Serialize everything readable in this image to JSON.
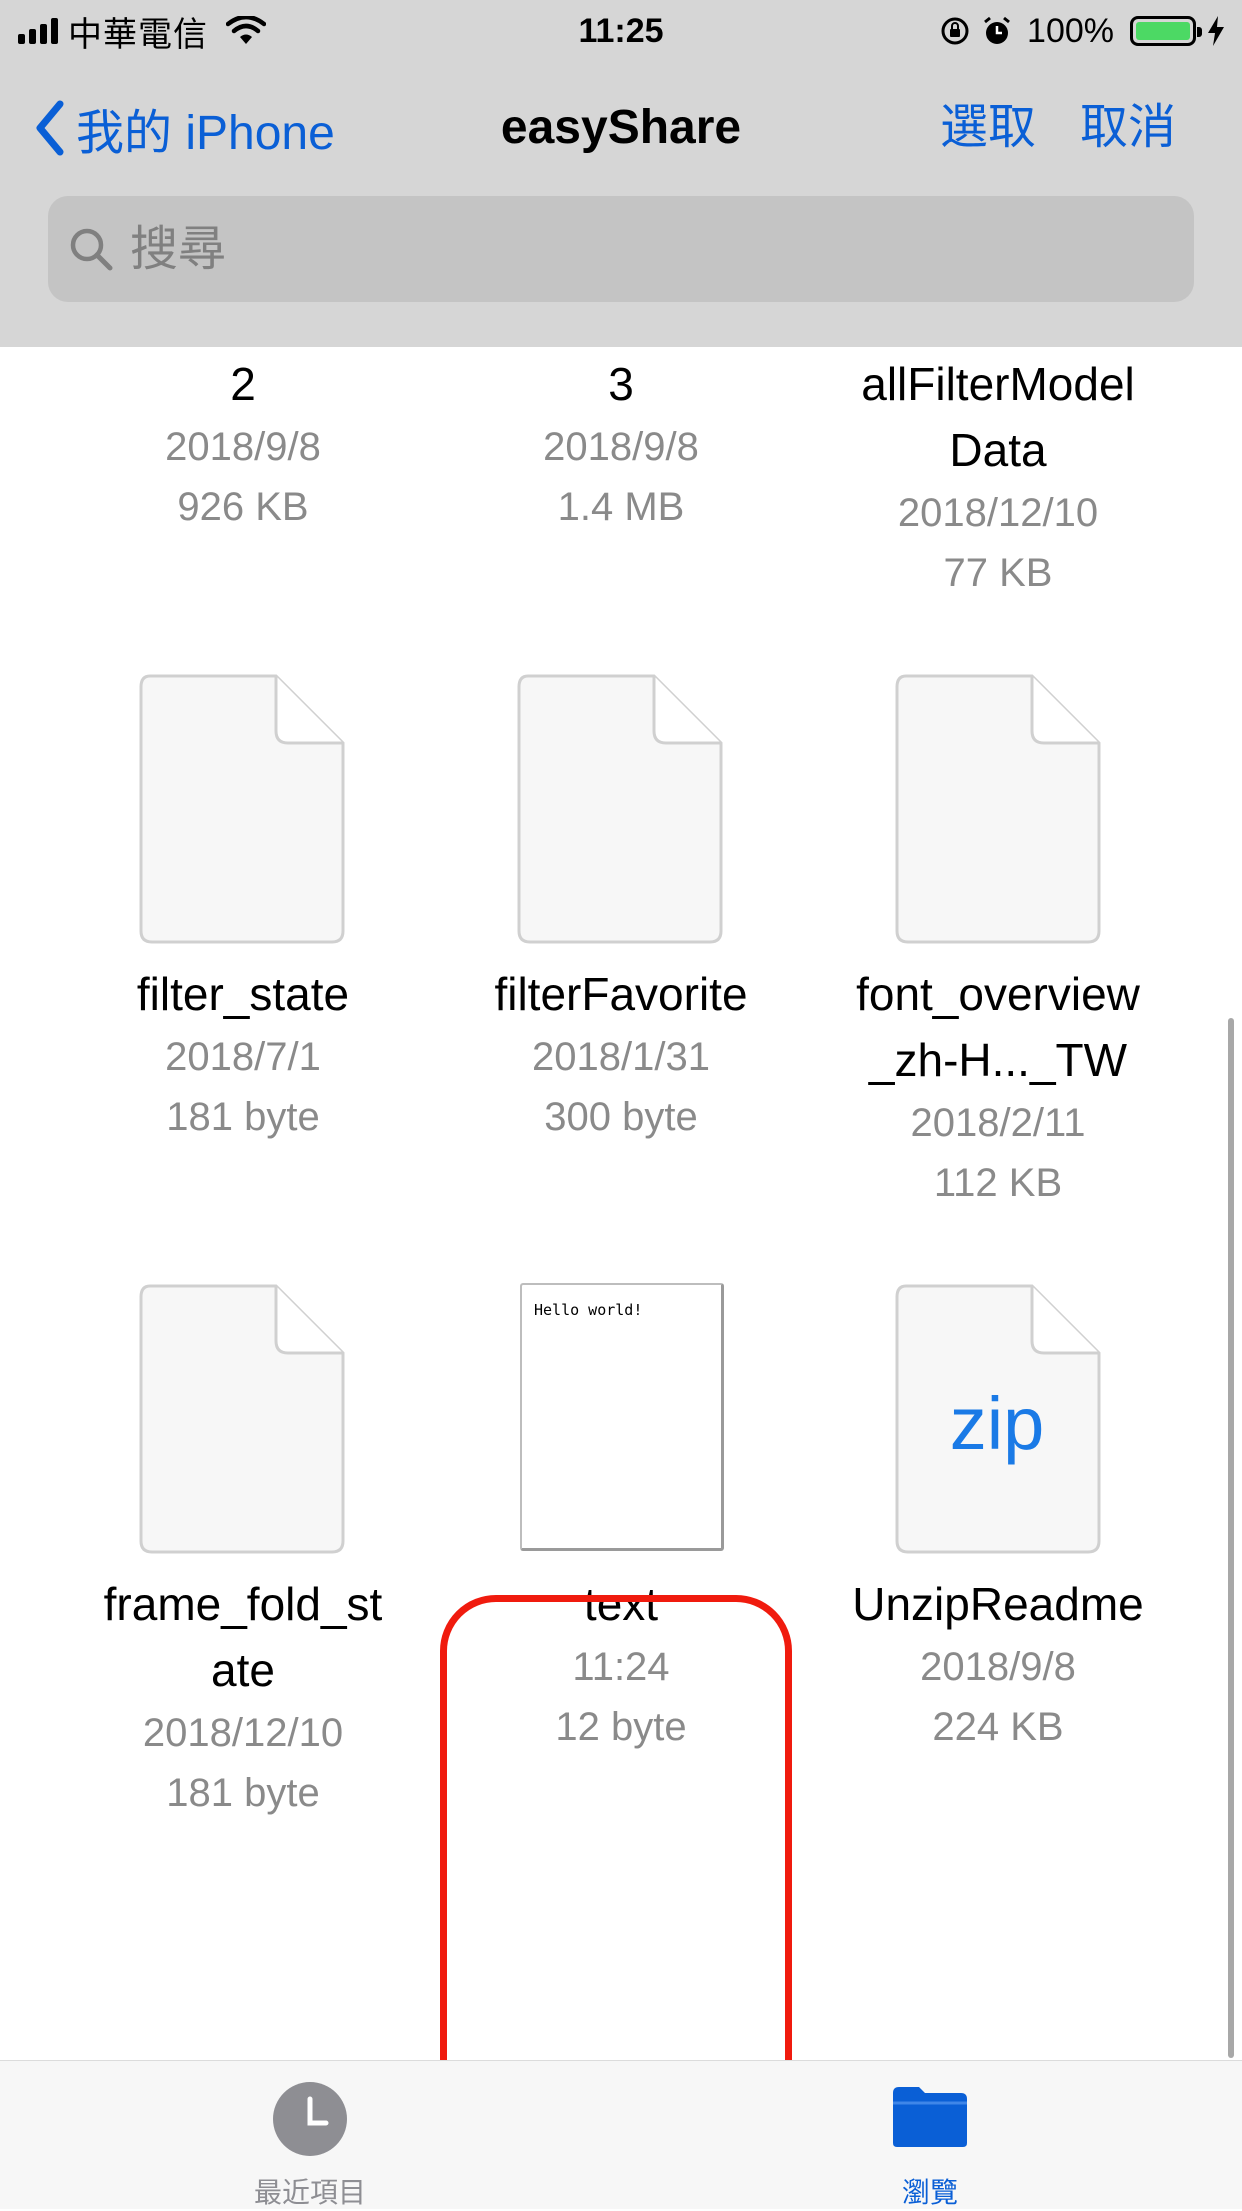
{
  "status_bar": {
    "carrier": "中華電信",
    "time": "11:25",
    "battery_percent": "100%"
  },
  "nav": {
    "back_label": "我的 iPhone",
    "title": "easyShare",
    "select_label": "選取",
    "cancel_label": "取消"
  },
  "search": {
    "placeholder": "搜尋"
  },
  "files": [
    {
      "name_lines": [
        "2"
      ],
      "date": "2018/9/8",
      "size": "926 KB"
    },
    {
      "name_lines": [
        "3"
      ],
      "date": "2018/9/8",
      "size": "1.4 MB"
    },
    {
      "name_lines": [
        "allFilterModel",
        "Data"
      ],
      "date": "2018/12/10",
      "size": "77 KB"
    },
    {
      "name_lines": [
        "filter_state"
      ],
      "date": "2018/7/1",
      "size": "181 byte",
      "icon": "blank-document-icon"
    },
    {
      "name_lines": [
        "filterFavorite"
      ],
      "date": "2018/1/31",
      "size": "300 byte",
      "icon": "blank-document-icon"
    },
    {
      "name_lines": [
        "font_overview",
        "_zh-H..._TW"
      ],
      "date": "2018/2/11",
      "size": "112 KB",
      "icon": "blank-document-icon"
    },
    {
      "name_lines": [
        "frame_fold_st",
        "ate"
      ],
      "date": "2018/12/10",
      "size": "181 byte",
      "icon": "blank-document-icon"
    },
    {
      "name_lines": [
        "text"
      ],
      "date": "11:24",
      "size": "12 byte",
      "icon": "text-document-preview",
      "preview_text": "Hello world!",
      "highlighted": true
    },
    {
      "name_lines": [
        "UnzipReadme"
      ],
      "date": "2018/9/8",
      "size": "224 KB",
      "icon": "zip-document-icon",
      "icon_label": "zip"
    }
  ],
  "tabs": {
    "recents_label": "最近項目",
    "browse_label": "瀏覽"
  },
  "colors": {
    "accent": "#0a5fd6",
    "highlight_border": "#f01b0e",
    "battery": "#4cd964",
    "header_bg": "#d6d6d6"
  }
}
